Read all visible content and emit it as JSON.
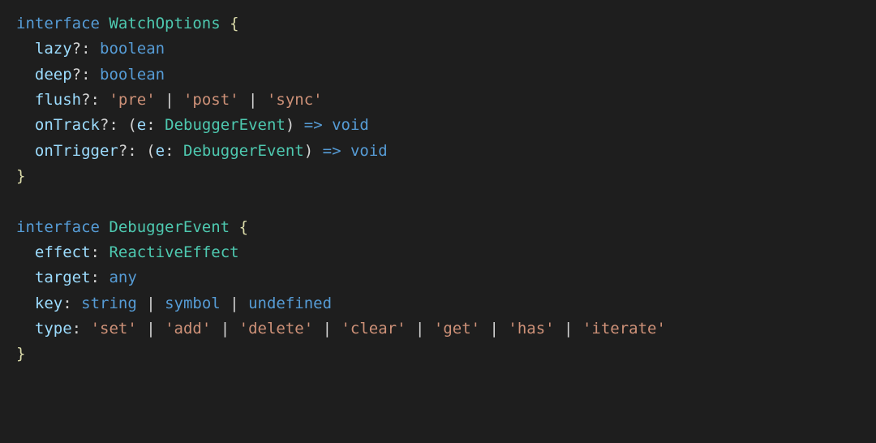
{
  "kw": {
    "interface": "interface",
    "boolean": "boolean",
    "void": "void",
    "any": "any",
    "string": "string",
    "symbol": "symbol",
    "undefined": "undefined"
  },
  "types": {
    "WatchOptions": "WatchOptions",
    "DebuggerEvent": "DebuggerEvent",
    "ReactiveEffect": "ReactiveEffect"
  },
  "props": {
    "lazy": "lazy",
    "deep": "deep",
    "flush": "flush",
    "onTrack": "onTrack",
    "onTrigger": "onTrigger",
    "e": "e",
    "effect": "effect",
    "target": "target",
    "key": "key",
    "type": "type"
  },
  "strings": {
    "pre": "'pre'",
    "post": "'post'",
    "sync": "'sync'",
    "set": "'set'",
    "add": "'add'",
    "delete": "'delete'",
    "clear": "'clear'",
    "get": "'get'",
    "has": "'has'",
    "iterate": "'iterate'"
  },
  "p": {
    "opt": "?:",
    "colon": ":",
    "lbrace": "{",
    "rbrace": "}",
    "lparen": "(",
    "rparen": ")",
    "pipe": " | ",
    "arrow": "=>",
    "sp": " ",
    "ind": "  "
  }
}
